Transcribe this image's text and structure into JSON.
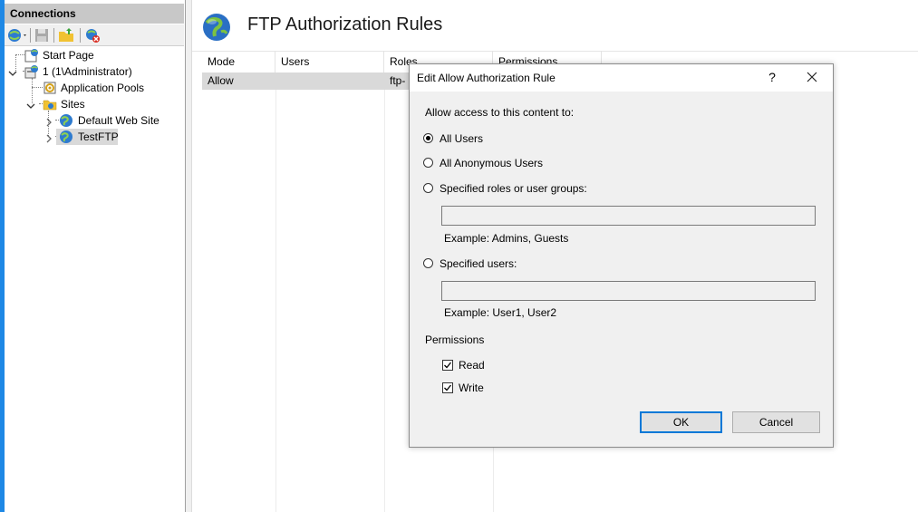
{
  "connections": {
    "header": "Connections",
    "toolbar": [
      "connect-icon",
      "save-icon",
      "up-folder-icon",
      "disconnect-icon"
    ],
    "tree": {
      "start_page": "Start Page",
      "server": "1 (1\\Administrator)",
      "app_pools": "Application Pools",
      "sites": "Sites",
      "default_site": "Default Web Site",
      "test_ftp": "TestFTP"
    }
  },
  "main": {
    "title": "FTP Authorization Rules",
    "columns": [
      "Mode",
      "Users",
      "Roles",
      "Permissions"
    ],
    "rows": [
      {
        "mode": "Allow",
        "users": "",
        "roles": "ftp-",
        "permissions": ""
      }
    ]
  },
  "dialog": {
    "title": "Edit Allow Authorization Rule",
    "help": "?",
    "prompt": "Allow access to this content to:",
    "options": {
      "all_users": "All Users",
      "all_anonymous": "All Anonymous Users",
      "specified_roles": "Specified roles or user groups:",
      "specified_users": "Specified users:"
    },
    "selected_option": "all_users",
    "roles_value": "",
    "roles_example": "Example: Admins, Guests",
    "users_value": "",
    "users_example": "Example: User1, User2",
    "permissions_label": "Permissions",
    "read_label": "Read",
    "write_label": "Write",
    "read_checked": true,
    "write_checked": true,
    "ok_label": "OK",
    "cancel_label": "Cancel"
  },
  "colors": {
    "accent": "#0078d7",
    "left_strip": "#1e88e5",
    "selection": "#d9d9d9"
  }
}
